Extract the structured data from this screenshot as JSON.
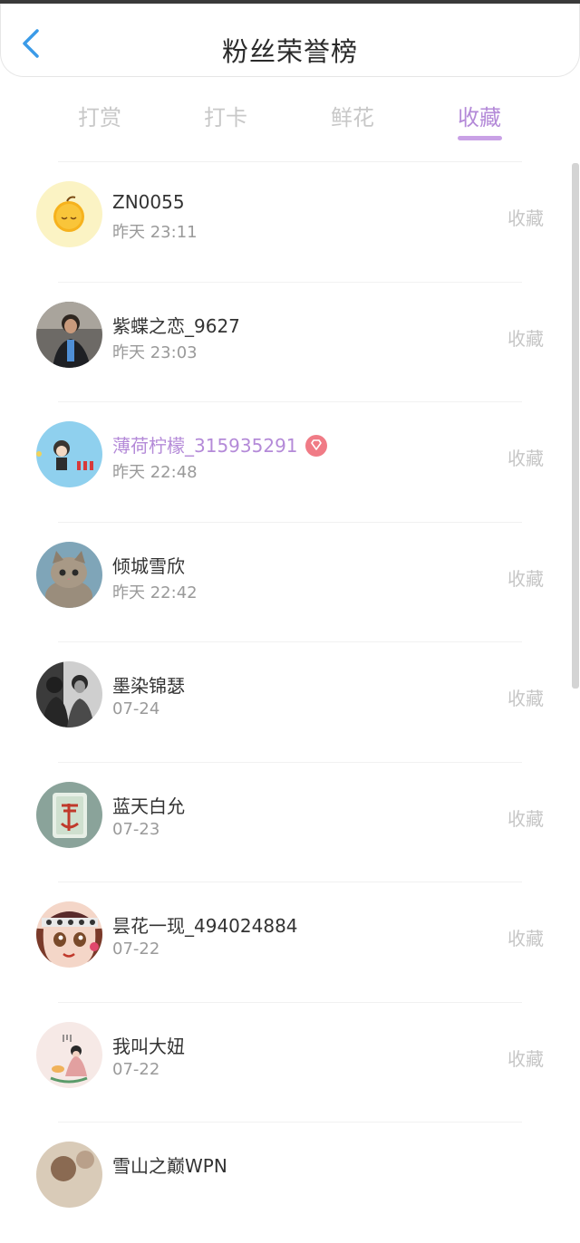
{
  "header": {
    "title": "粉丝荣誉榜"
  },
  "tabs": [
    {
      "label": "打赏"
    },
    {
      "label": "打卡"
    },
    {
      "label": "鲜花"
    },
    {
      "label": "收藏"
    }
  ],
  "list": [
    {
      "name": "ZN0055",
      "time": "昨天 23:11",
      "action": "收藏",
      "avatar": "orange-emoji-avatar"
    },
    {
      "name": "紫蝶之恋_9627",
      "time": "昨天 23:03",
      "action": "收藏",
      "avatar": "man-photo-avatar"
    },
    {
      "name": "薄荷柠檬_315935291",
      "time": "昨天 22:48",
      "action": "收藏",
      "avatar": "cartoon-boy-avatar"
    },
    {
      "name": "倾城雪欣",
      "time": "昨天 22:42",
      "action": "收藏",
      "avatar": "kitten-avatar"
    },
    {
      "name": "墨染锦瑟",
      "time": "07-24",
      "action": "收藏",
      "avatar": "couple-photo-avatar"
    },
    {
      "name": "蓝天白允",
      "time": "07-23",
      "action": "收藏",
      "avatar": "love-tile-avatar"
    },
    {
      "name": "昙花一现_494024884",
      "time": "07-22",
      "action": "收藏",
      "avatar": "doll-avatar"
    },
    {
      "name": "我叫大妞",
      "time": "07-22",
      "action": "收藏",
      "avatar": "girl-drawing-avatar"
    },
    {
      "name": "雪山之巅WPN",
      "time": "",
      "action": "",
      "avatar": "partial-avatar"
    }
  ],
  "colors": {
    "accent": "#b48ad8",
    "back_arrow": "#3b9be8",
    "badge": "#f07b86"
  }
}
